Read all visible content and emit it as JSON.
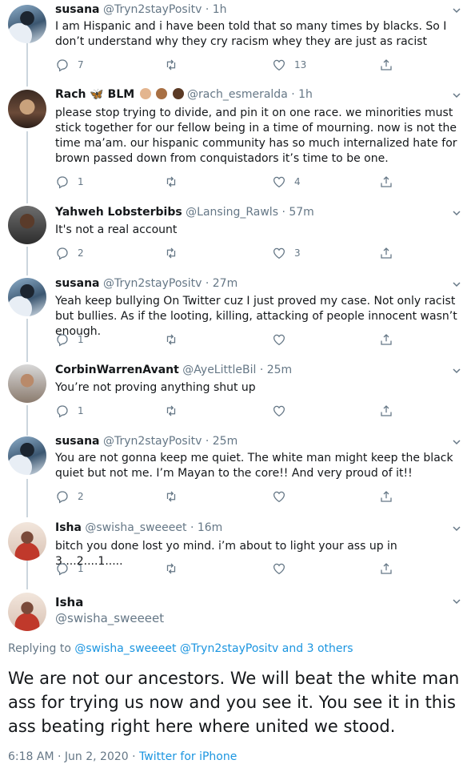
{
  "tweets": [
    {
      "name": "susana",
      "handle": "@Tryn2stayPositv",
      "time": "1h",
      "text": "I am Hispanic and i have been told that so many times by blacks. So I don’t understand why they cry racism whey they are just as racist",
      "replies": "7",
      "retweets": "",
      "likes": "13"
    },
    {
      "name": "Rach 🦋 BLM",
      "handle": "@rach_esmeralda",
      "time": "1h",
      "text": "please stop trying to divide, and pin it on one race. we minorities must stick together for our fellow being in a time of mourning. now is not the time ma’am. our hispanic community has so much internalized hate for brown passed down from conquistadors it’s time to be one.",
      "replies": "1",
      "retweets": "",
      "likes": "4"
    },
    {
      "name": "Yahweh Lobsterbibs",
      "handle": "@Lansing_Rawls",
      "time": "57m",
      "text": "It's not a real account",
      "replies": "2",
      "retweets": "",
      "likes": "3"
    },
    {
      "name": "susana",
      "handle": "@Tryn2stayPositv",
      "time": "27m",
      "text": "Yeah keep bullying On Twitter cuz I just proved my case. Not only racist but bullies. As if the looting, killing, attacking of people innocent wasn’t enough.",
      "replies": "1",
      "retweets": "",
      "likes": ""
    },
    {
      "name": "CorbinWarrenAvant",
      "handle": "@AyeLittleBil",
      "time": "25m",
      "text": "You’re not proving anything shut up",
      "replies": "1",
      "retweets": "",
      "likes": ""
    },
    {
      "name": "susana",
      "handle": "@Tryn2stayPositv",
      "time": "25m",
      "text": "You are not gonna keep me quiet. The white man might keep the black quiet but not me. I’m Mayan to the core!! And very proud of it!!",
      "replies": "2",
      "retweets": "",
      "likes": ""
    },
    {
      "name": "Isha",
      "handle": "@swisha_sweeeet",
      "time": "16m",
      "text": "bitch you done lost yo mind. i’m about to light your ass up in 3....2....1.....",
      "replies": "1",
      "retweets": "",
      "likes": ""
    }
  ],
  "main_tweet": {
    "name": "Isha",
    "handle": "@swisha_sweeeet",
    "replying_prefix": "Replying to",
    "replying_to": "@swisha_sweeeet @Tryn2stayPositv",
    "replying_and": "and 3 others",
    "text": "We are not our ancestors. We will beat the white man ass for trying us now and you see it. You see it in this ass beating right here where united we stood.",
    "time": "6:18 AM",
    "date": "Jun 2, 2020",
    "source": "Twitter for iPhone"
  },
  "colors": {
    "text": "#14171a",
    "meta": "#657786",
    "link": "#1b95e0",
    "thread_line": "#ccd6dd"
  },
  "icons": [
    "reply-icon",
    "retweet-icon",
    "like-icon",
    "share-icon",
    "chevron-down-icon"
  ]
}
